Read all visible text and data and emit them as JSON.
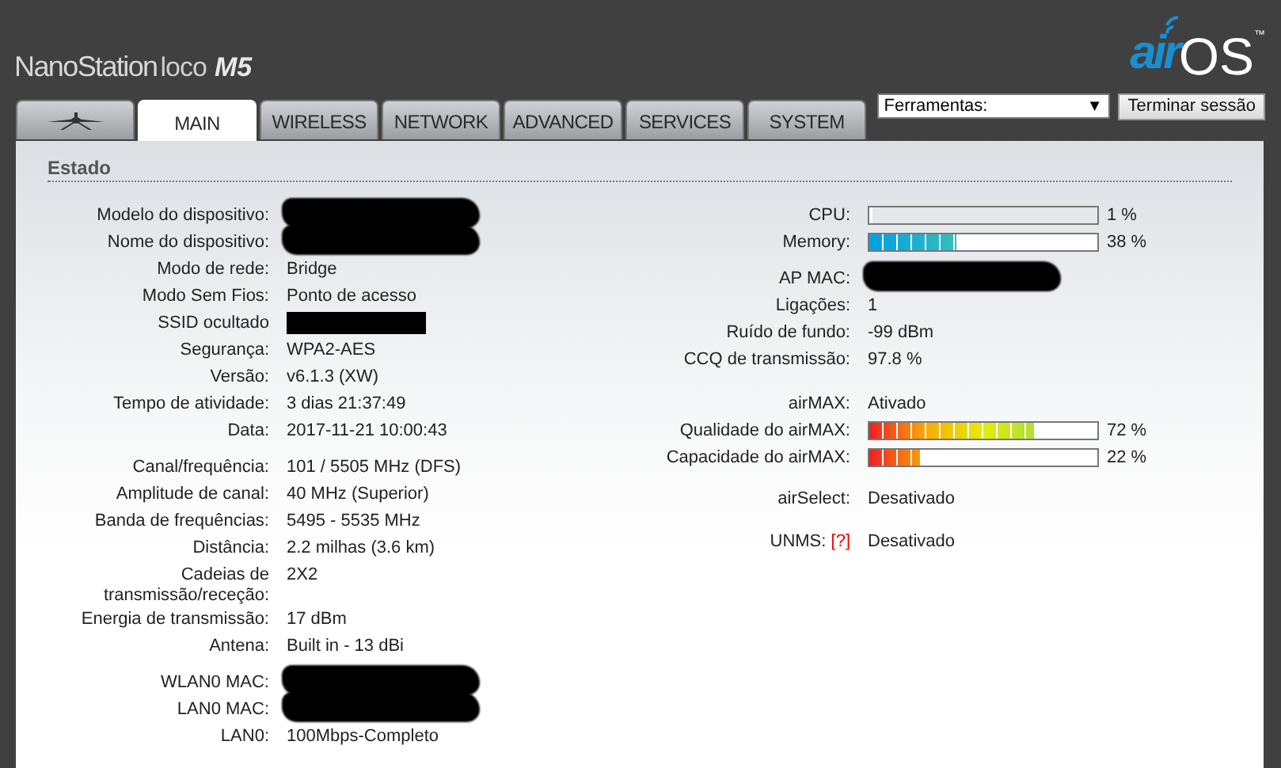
{
  "header": {
    "product": {
      "name": "NanoStation",
      "variant": "loco",
      "model": "M5"
    },
    "logo": {
      "prefix": "air",
      "suffix": "OS",
      "mark": "™"
    }
  },
  "tabs": [
    {
      "kind": "logo",
      "selected": false
    },
    {
      "label": "MAIN",
      "selected": true
    },
    {
      "label": "WIRELESS",
      "selected": false
    },
    {
      "label": "NETWORK",
      "selected": false
    },
    {
      "label": "ADVANCED",
      "selected": false
    },
    {
      "label": "SERVICES",
      "selected": false
    },
    {
      "label": "SYSTEM",
      "selected": false
    }
  ],
  "tools": {
    "value": "Ferramentas:",
    "arrow": "▼",
    "logout": "Terminar sessão"
  },
  "section_title": "Estado",
  "left_groups": [
    [
      {
        "label": "Modelo do dispositivo:",
        "redacted": true
      },
      {
        "label": "Nome do dispositivo:",
        "redacted": true
      },
      {
        "label": "Modo de rede:",
        "value": "Bridge"
      },
      {
        "label": "Modo Sem Fios:",
        "value": "Ponto de acesso"
      },
      {
        "label": "SSID ocultado",
        "redacted": true
      },
      {
        "label": "Segurança:",
        "value": "WPA2-AES"
      },
      {
        "label": "Versão:",
        "value": "v6.1.3 (XW)"
      },
      {
        "label": "Tempo de atividade:",
        "value": "3 dias 21:37:49"
      },
      {
        "label": "Data:",
        "value": "2017-11-21 10:00:43"
      }
    ],
    [
      {
        "label": "Canal/frequência:",
        "value": "101 / 5505 MHz (DFS)"
      },
      {
        "label": "Amplitude de canal:",
        "value": "40 MHz (Superior)"
      },
      {
        "label": "Banda de frequências:",
        "value": "5495 - 5535 MHz"
      },
      {
        "label": "Distância:",
        "value": "2.2 milhas (3.6 km)"
      },
      {
        "label": "Cadeias de transmissão/receção:",
        "value": "2X2"
      },
      {
        "label": "Energia de transmissão:",
        "value": "17 dBm"
      },
      {
        "label": "Antena:",
        "value": "Built in - 13 dBi"
      }
    ],
    [
      {
        "label": "WLAN0 MAC:",
        "redacted": true
      },
      {
        "label": "LAN0 MAC:",
        "redacted": true
      },
      {
        "label": "LAN0:",
        "value": "100Mbps-Completo"
      }
    ]
  ],
  "right_groups": [
    [
      {
        "kind": "bar",
        "label": "CPU:",
        "reading": "1 %"
      },
      {
        "kind": "bar",
        "label": "Memory:",
        "level": 0.38,
        "reading": "38 %"
      }
    ],
    [
      {
        "kind": "text",
        "label": "AP MAC:",
        "redacted": true
      },
      {
        "kind": "text",
        "label": "Ligações:",
        "value": "1"
      },
      {
        "kind": "text",
        "label": "Ruído de fundo:",
        "value": "-99 dBm"
      },
      {
        "kind": "text",
        "label": "CCQ de transmissão:",
        "value": "97.8 %"
      }
    ],
    [
      {
        "kind": "text",
        "label": "airMAX:",
        "value": "Ativado"
      },
      {
        "kind": "bar",
        "label": "Qualidade do airMAX:",
        "level": 0.72,
        "reading": "72 %"
      },
      {
        "kind": "bar",
        "label": "Capacidade do airMAX:",
        "level": 0.22,
        "reading": "22 %"
      }
    ],
    [
      {
        "kind": "text",
        "label": "airSelect:",
        "value": "Desativado"
      }
    ],
    [
      {
        "kind": "text",
        "label": "UNMS:",
        "help": "[?]",
        "value": "Desativado"
      }
    ]
  ]
}
